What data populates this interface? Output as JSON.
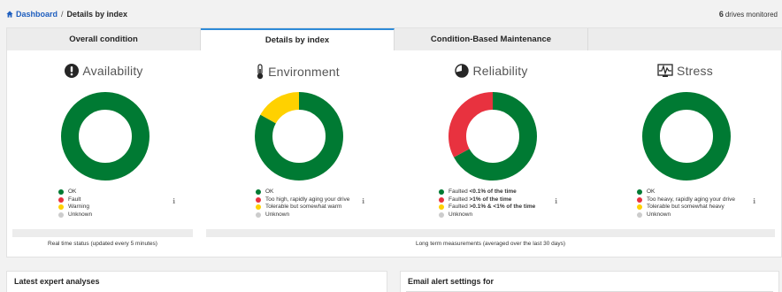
{
  "breadcrumb": {
    "home": "Dashboard",
    "separator": "/",
    "current": "Details by index"
  },
  "drives": {
    "count": "6",
    "label": "drives monitored"
  },
  "tabs": [
    {
      "label": "Overall condition",
      "active": false
    },
    {
      "label": "Details by index",
      "active": true
    },
    {
      "label": "Condition-Based Maintenance",
      "active": false
    }
  ],
  "colors": {
    "green": "#007a33",
    "red": "#e8323f",
    "yellow": "#ffd100",
    "gray": "#cccccc",
    "accent": "#2e8bd8",
    "link": "#1f5fbf"
  },
  "cards": [
    {
      "title": "Availability",
      "icon": "exclamation-circle-icon",
      "donut": [
        {
          "status": "ok",
          "share": 1.0
        }
      ],
      "legend": [
        {
          "color": "green",
          "text": "OK",
          "bold": ""
        },
        {
          "color": "red",
          "text": "Fault",
          "bold": ""
        },
        {
          "color": "yellow",
          "text": "Warning",
          "bold": ""
        },
        {
          "color": "gray",
          "text": "Unknown",
          "bold": ""
        }
      ]
    },
    {
      "title": "Environment",
      "icon": "thermometer-icon",
      "donut": [
        {
          "status": "ok",
          "share": 0.83
        },
        {
          "status": "tolerable",
          "share": 0.17
        }
      ],
      "legend": [
        {
          "color": "green",
          "text": "OK",
          "bold": ""
        },
        {
          "color": "red",
          "text": "Too high, rapidly aging your drive",
          "bold": ""
        },
        {
          "color": "yellow",
          "text": "Tolerable but somewhat warm",
          "bold": ""
        },
        {
          "color": "gray",
          "text": "Unknown",
          "bold": ""
        }
      ]
    },
    {
      "title": "Reliability",
      "icon": "pie-chart-icon",
      "donut": [
        {
          "status": "faulted <0.1% of the time",
          "share": 0.67
        },
        {
          "status": "faulted >1% of the time",
          "share": 0.33
        }
      ],
      "legend": [
        {
          "color": "green",
          "text": "Faulted ",
          "bold": "<0.1% of the time"
        },
        {
          "color": "red",
          "text": "Faulted ",
          "bold": ">1% of the time"
        },
        {
          "color": "yellow",
          "text": "Faulted ",
          "bold": ">0.1% & <1% of the time"
        },
        {
          "color": "gray",
          "text": "Unknown",
          "bold": ""
        }
      ]
    },
    {
      "title": "Stress",
      "icon": "waveform-monitor-icon",
      "donut": [
        {
          "status": "ok",
          "share": 1.0
        }
      ],
      "legend": [
        {
          "color": "green",
          "text": "OK",
          "bold": ""
        },
        {
          "color": "red",
          "text": "Too heavy, rapidly aging your drive",
          "bold": ""
        },
        {
          "color": "yellow",
          "text": "Tolerable but somewhat heavy",
          "bold": ""
        },
        {
          "color": "gray",
          "text": "Unknown",
          "bold": ""
        }
      ]
    }
  ],
  "captions": {
    "realtime": "Real time status (updated every 5 minutes)",
    "longterm": "Long term measurements (averaged over the last 30 days)"
  },
  "sections": {
    "analyses": "Latest expert analyses",
    "email": "Email alert settings for"
  }
}
